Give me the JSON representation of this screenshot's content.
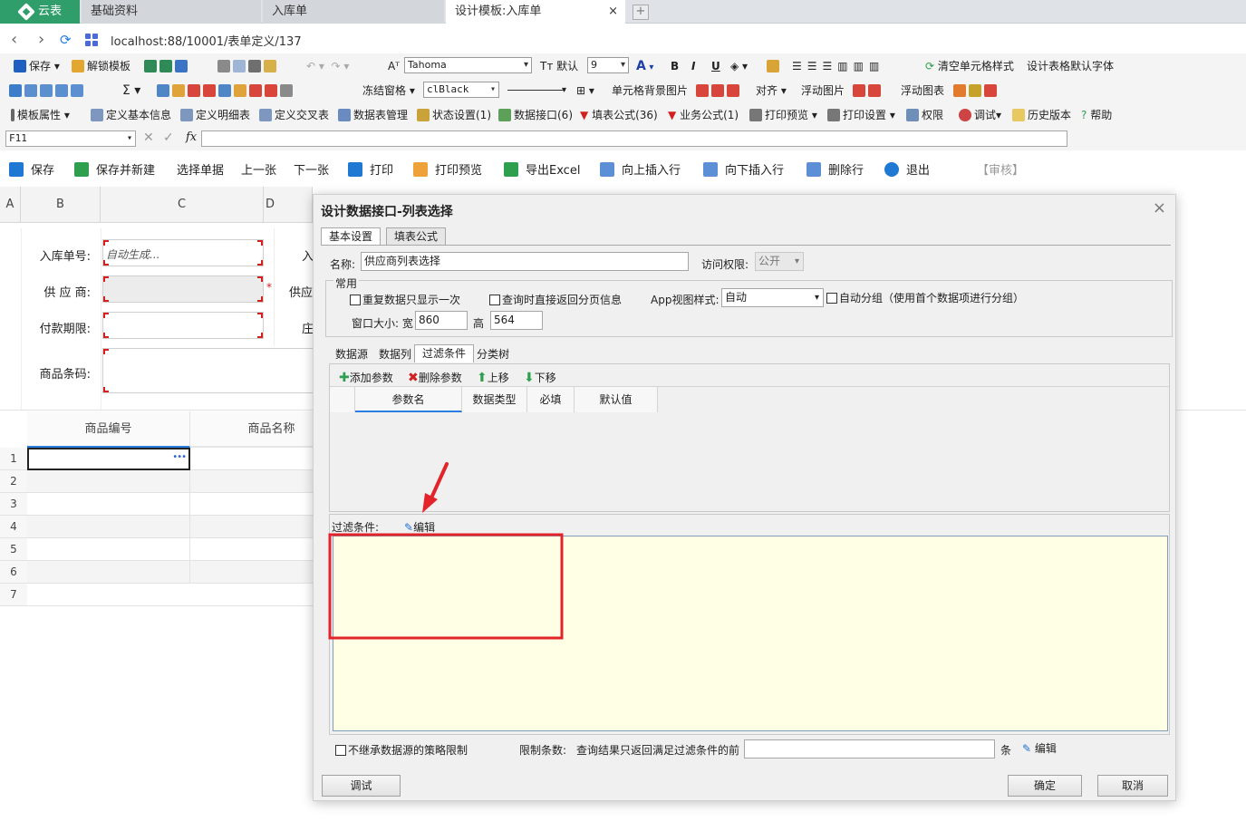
{
  "tabs": {
    "app": "云表",
    "t1": "基础资料",
    "t2": "入库单",
    "t3": "设计模板:入库单",
    "close": "×",
    "add": "+"
  },
  "url": "localhost:88/10001/表单定义/137",
  "toolbar1": {
    "save": "保存",
    "unlock": "解锁模板",
    "font": "Tahoma",
    "default": "默认",
    "size": "9",
    "bold": "B",
    "italic": "I",
    "underline": "U",
    "clear": "清空单元格样式",
    "deffont": "设计表格默认字体"
  },
  "toolbar2": {
    "freeze": "冻结窗格",
    "color": "clBlack",
    "bgimg": "单元格背景图片",
    "align": "对齐",
    "floatimg": "浮动图片",
    "floatchart": "浮动图表"
  },
  "toolbar3": {
    "props": "模板属性",
    "basic": "定义基本信息",
    "detail": "定义明细表",
    "cross": "定义交叉表",
    "dsm": "数据表管理",
    "state": "状态设置(1)",
    "iface": "数据接口(6)",
    "fill": "填表公式(36)",
    "biz": "业务公式(1)",
    "preview": "打印预览",
    "printset": "打印设置",
    "perm": "权限",
    "debug": "调试",
    "history": "历史版本",
    "help": "帮助"
  },
  "formula": {
    "cellref": "F11"
  },
  "actions": {
    "save": "保存",
    "savenew": "保存并新建",
    "select": "选择单据",
    "prev": "上一张",
    "next": "下一张",
    "print": "打印",
    "preview": "打印预览",
    "export": "导出Excel",
    "insup": "向上插入行",
    "insdown": "向下插入行",
    "delrow": "删除行",
    "exit": "退出",
    "audit": "【审核】"
  },
  "sheet": {
    "cols": [
      "A",
      "B",
      "C",
      "D"
    ],
    "l1": "入库单号:",
    "v1": "自动生成...",
    "l2": "供 应 商:",
    "l3": "付款期限:",
    "l4": "商品条码:",
    "star": "*",
    "p1": "入",
    "p2": "供应",
    "p3": "庄",
    "gh1": "商品编号",
    "gh2": "商品名称",
    "dots": "•••",
    "rows": [
      "1",
      "2",
      "3",
      "4",
      "5",
      "6",
      "7"
    ]
  },
  "dialog": {
    "title": "设计数据接口-列表选择",
    "tab_basic": "基本设置",
    "tab_formula": "填表公式",
    "name_label": "名称:",
    "name_value": "供应商列表选择",
    "access_label": "访问权限:",
    "access_value": "公开",
    "common": "常用",
    "cb1": "重复数据只显示一次",
    "cb2": "查询时直接返回分页信息",
    "appview_label": "App视图样式:",
    "appview_value": "自动",
    "cb3": "自动分组（使用首个数据项进行分组）",
    "winsize": "窗口大小: 宽",
    "width": "860",
    "height_label": "高",
    "height": "564",
    "sub_tabs": [
      "数据源",
      "数据列",
      "过滤条件",
      "分类树"
    ],
    "add_param": "添加参数",
    "del_param": "删除参数",
    "move_up": "上移",
    "move_down": "下移",
    "cols": [
      "参数名",
      "数据类型",
      "必填",
      "默认值"
    ],
    "filter_label": "过滤条件:",
    "edit": "编辑",
    "no_inherit": "不继承数据源的策略限制",
    "limit_label": "限制条数:",
    "limit_desc": "查询结果只返回满足过滤条件的前",
    "unit": "条",
    "edit2": "编辑",
    "debug": "调试",
    "ok": "确定",
    "cancel": "取消"
  },
  "colors": {
    "accent": "#2f9e6b",
    "highlight": "#e3232a",
    "filter_bg": "#ffffe6",
    "link": "#1f6fd1"
  }
}
